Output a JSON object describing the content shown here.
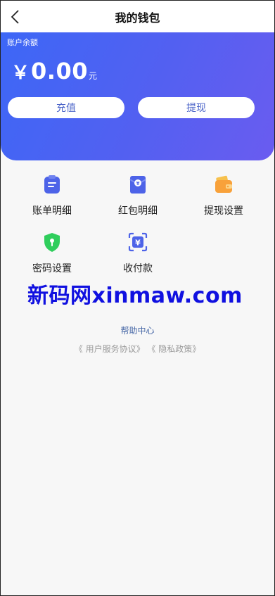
{
  "header": {
    "title": "我的钱包",
    "back_icon": "chevron-left-icon"
  },
  "balance": {
    "label": "账户余额",
    "symbol": "￥",
    "amount": "0.00",
    "unit": "元",
    "recharge_label": "充值",
    "withdraw_label": "提现"
  },
  "menu": [
    {
      "label": "账单明细",
      "icon": "clipboard-icon"
    },
    {
      "label": "红包明细",
      "icon": "red-envelope-yuan-icon"
    },
    {
      "label": "提现设置",
      "icon": "wallet-icon"
    },
    {
      "label": "密码设置",
      "icon": "shield-icon"
    },
    {
      "label": "收付款",
      "icon": "scan-yuan-icon"
    }
  ],
  "watermark": "新码网xinmaw.com",
  "footer": {
    "help_label": "帮助中心",
    "user_agreement": "《 用户服务协议》",
    "privacy_policy": "《 隐私政策》"
  },
  "colors": {
    "hero_gradient_start": "#3d67f6",
    "hero_gradient_end": "#6a5cf0",
    "button_text": "#4a63c8",
    "link": "#4a6aa8",
    "watermark": "#1010e0"
  }
}
